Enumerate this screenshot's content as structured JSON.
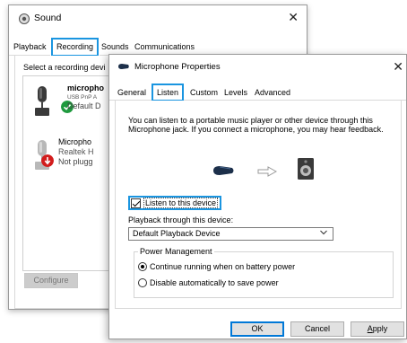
{
  "sound_window": {
    "title": "Sound",
    "tabs": [
      {
        "label": "Playback"
      },
      {
        "label": "Recording"
      },
      {
        "label": "Sounds"
      },
      {
        "label": "Communications"
      }
    ],
    "select_text": "Select a recording devi",
    "devices": [
      {
        "line1": "micropho",
        "line2": "USB PnP A",
        "line3": "Default D",
        "status": "default",
        "status_color": "#1f9a3e"
      },
      {
        "line1": "Micropho",
        "line2": "Realtek H",
        "line3": "Not plugg",
        "status": "unplugged",
        "status_color": "#d21c1c"
      }
    ],
    "configure_label": "Configure"
  },
  "mic_window": {
    "title": "Microphone Properties",
    "tabs": [
      {
        "label": "General"
      },
      {
        "label": "Listen"
      },
      {
        "label": "Custom"
      },
      {
        "label": "Levels"
      },
      {
        "label": "Advanced"
      }
    ],
    "description": "You can listen to a portable music player or other device through this Microphone jack.  If you connect a microphone, you may hear feedback.",
    "listen_checkbox": {
      "label": "Listen to this device",
      "checked": true
    },
    "playback_label": "Playback through this device:",
    "playback_select": {
      "value": "Default Playback Device"
    },
    "power_group": {
      "title": "Power Management",
      "options": [
        {
          "label": "Continue running when on battery power",
          "selected": true
        },
        {
          "label": "Disable automatically to save power",
          "selected": false
        }
      ]
    },
    "buttons": {
      "ok": "OK",
      "cancel": "Cancel",
      "apply_prefix": "A",
      "apply_rest": "pply"
    }
  },
  "colors": {
    "highlight": "#1a95e0",
    "ok_border": "#0078d7"
  }
}
